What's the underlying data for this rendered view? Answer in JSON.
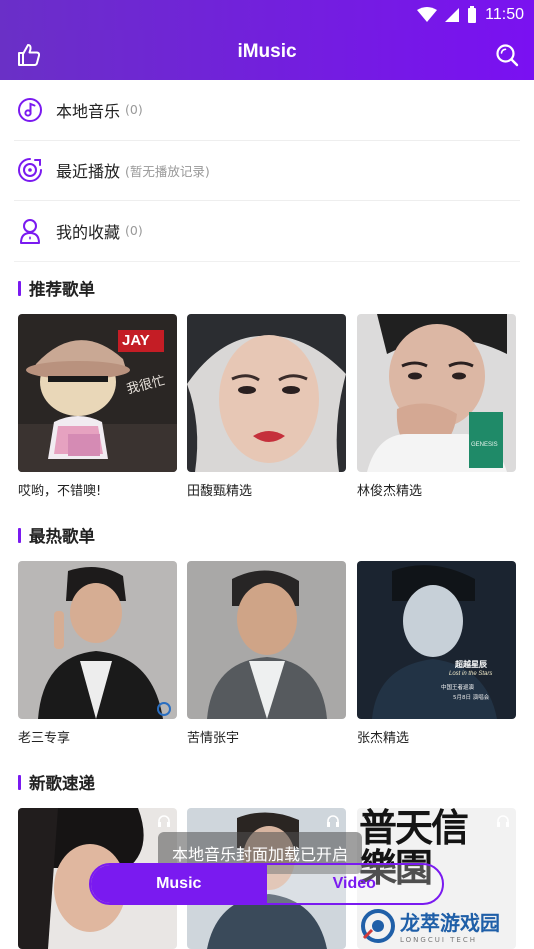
{
  "status": {
    "time": "11:50"
  },
  "header": {
    "title": "iMusic"
  },
  "menu": [
    {
      "label": "本地音乐",
      "count": "(0)"
    },
    {
      "label": "最近播放",
      "count": "(暂无播放记录)"
    },
    {
      "label": "我的收藏",
      "count": "(0)"
    }
  ],
  "sections": [
    {
      "title": "推荐歌单",
      "cards": [
        "哎哟，不错噢!",
        "田馥甄精选",
        "林俊杰精选"
      ]
    },
    {
      "title": "最热歌单",
      "cards": [
        "老三专享",
        "苦情张宇",
        "张杰精选"
      ]
    },
    {
      "title": "新歌速递"
    }
  ],
  "covers": {
    "jay_badge": "JAY",
    "jay_sign": "我很忙",
    "lin_badge": "GENESIS",
    "zhang_line1": "超越星辰",
    "zhang_line2": "Lost in the Stars",
    "zhang_line3": "中国王者巡演",
    "zhang_line4": "5月8日 演唱会"
  },
  "toast": "本地音乐封面加载已开启",
  "switch": {
    "music": "Music",
    "video": "Video"
  },
  "overlay_art": "普天信 樂園",
  "watermark": {
    "main": "龙萃游戏园",
    "sub": "LONGCUI TECH"
  },
  "colors": {
    "accent": "#7a1af0",
    "header": "#6a2fc8"
  }
}
